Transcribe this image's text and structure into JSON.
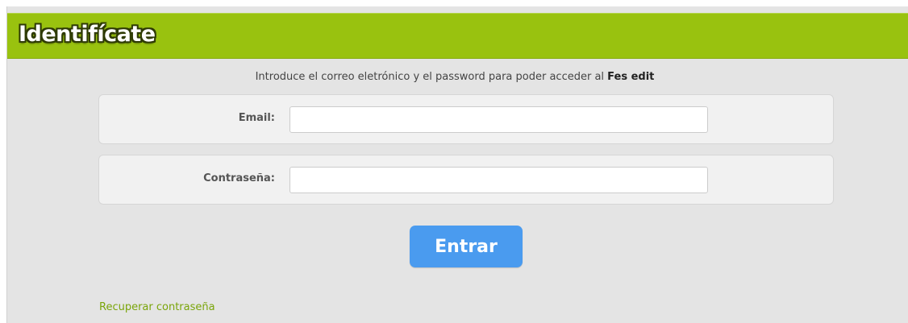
{
  "header": {
    "title": "Identifícate"
  },
  "intro": {
    "text": "Introduce el correo eletrónico y el password para poder acceder al ",
    "bold": "Fes edit"
  },
  "form": {
    "email_label": "Email:",
    "email_value": "",
    "email_placeholder": "",
    "password_label": "Contraseña:",
    "password_value": "",
    "password_placeholder": "",
    "submit_label": "Entrar"
  },
  "links": {
    "recover_password": "Recuperar contraseña"
  },
  "colors": {
    "header_green": "#99c20f",
    "button_blue": "#4a9bef",
    "link_green": "#7aa50a",
    "panel_gray": "#e4e4e4"
  }
}
